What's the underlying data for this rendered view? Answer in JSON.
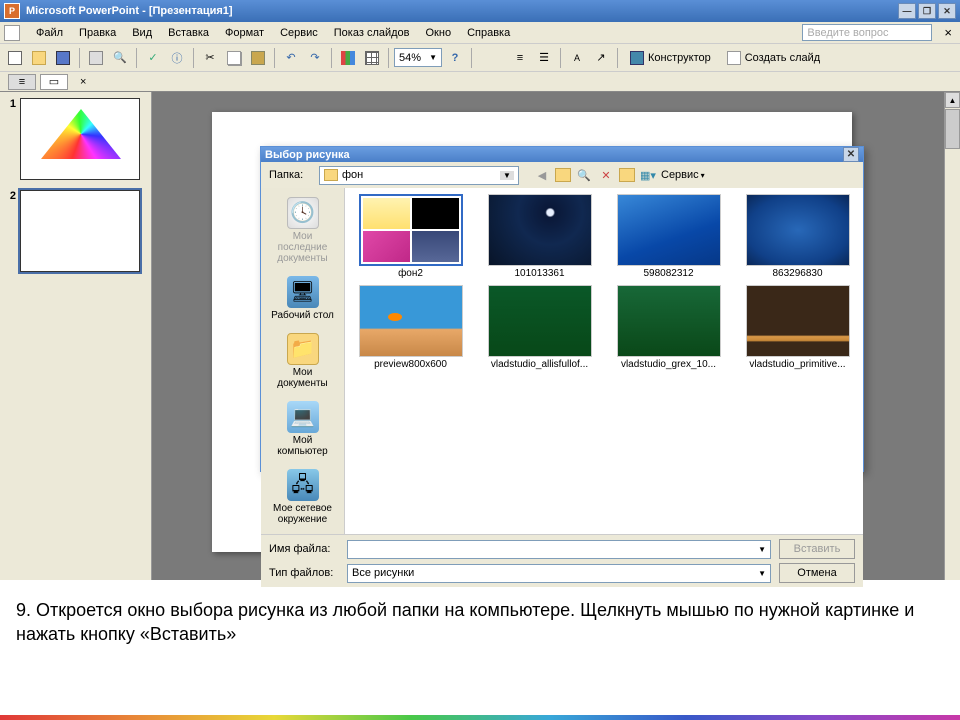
{
  "titlebar": {
    "app": "Microsoft PowerPoint - [Презентация1]"
  },
  "menu": {
    "items": [
      "Файл",
      "Правка",
      "Вид",
      "Вставка",
      "Формат",
      "Сервис",
      "Показ слайдов",
      "Окно",
      "Справка"
    ],
    "question_placeholder": "Введите вопрос"
  },
  "toolbar": {
    "zoom": "54%",
    "designer": "Конструктор",
    "newslide": "Создать слайд"
  },
  "slides": {
    "n1": "1",
    "n2": "2"
  },
  "dialog": {
    "title": "Выбор рисунка",
    "folder_label": "Папка:",
    "folder_value": "фон",
    "service": "Сервис",
    "places": {
      "recent": "Мои последние документы",
      "desktop": "Рабочий стол",
      "mydocs": "Мои документы",
      "mycomp": "Мой компьютер",
      "network": "Мое сетевое окружение"
    },
    "files": {
      "f1": "фон2",
      "f2": "101013361",
      "f3": "598082312",
      "f4": "863296830",
      "f5": "preview800x600",
      "f6": "vladstudio_allisfullof...",
      "f7": "vladstudio_grex_10...",
      "f8": "vladstudio_primitive..."
    },
    "filename_label": "Имя файла:",
    "filetype_label": "Тип файлов:",
    "filetype_value": "Все рисунки",
    "insert": "Вставить",
    "cancel": "Отмена"
  },
  "caption": "9.   Откроется окно выбора рисунка из любой папки на компьютере. Щелкнуть мышью по нужной картинке и нажать кнопку «Вставить»"
}
